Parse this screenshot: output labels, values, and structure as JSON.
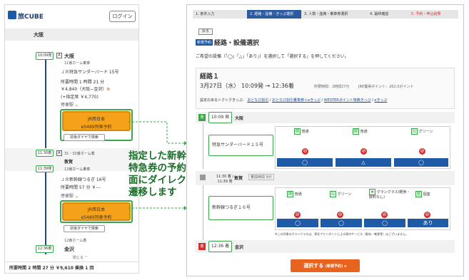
{
  "phone": {
    "logo": "旅CUBE",
    "login": "ログイン",
    "time_label": "10:09",
    "origin_header": "大阪",
    "leg1": {
      "dep_time": "10:09発",
      "platform_badge": "A",
      "station": "大阪",
      "platform": "11番ホーム乗車",
      "train": "ＪＲ特急サンダーバード 15号",
      "duration": "所要時間 1 時間 21 分",
      "fare": "￥4,840（大阪−金沢）",
      "fare_star": "※",
      "extra_fare": "(+指定席 ￥4,770)",
      "stops": "停車駅 ⌄",
      "reserve_line1": "JR西日本",
      "reserve_line2": "e5489列車予約",
      "around": "前後ダイヤで検索"
    },
    "transfer": {
      "arr_time": "11:30着",
      "badge": "A",
      "arr_platform": "31・32番ホーム着",
      "station": "敦賀",
      "dep_time": "11:39発",
      "dep_platform": "12番ホーム乗車"
    },
    "leg2": {
      "train": "ＪＲ新幹線つるぎ 16号",
      "duration": "所要時間 57 分 ￥---",
      "stops": "停車駅 ⌄",
      "reserve_line1": "JR西日本",
      "reserve_line2": "e5489列車予約",
      "around": "前後ダイヤで検索"
    },
    "arrival": {
      "platform": "12番ホーム着",
      "time": "12:36着",
      "station": "金沢",
      "close": "閉じる ⌃"
    },
    "footer": "所要時間 2 時間 27 分 ￥9,610 乗換 1 回"
  },
  "callout": [
    "指定した新幹線・",
    "特急券の予約画",
    "面にダイレクトに",
    "遷移します"
  ],
  "panel": {
    "steps": [
      "1. 条件入力",
      "2. 経路・設備・きっぷ選択",
      "3. 人数・座席・乗車券選択",
      "4. 最終確認",
      "5. 予約・申込結果"
    ],
    "back": "戻る",
    "badge": "新規予約",
    "title": "経路・設備選択",
    "instruction": "ご希望の設備（「◯」「△」「あり」）を選択して「選択する」を押してください。",
    "route_name": "経路１",
    "date": "3月27日（水）",
    "times": "10:09発 → 12:36着",
    "duration": "所要時間：2時間27分",
    "points": "JRE獲得ポイント：262.0ポイント",
    "tickets_label": "設定のあるトクトクきっぷ：",
    "tickets": [
      "おとなび割引",
      "おとなび割引乗車券＋eきっぷ",
      "WESTERポイント特典きっぷ",
      "eきっぷ"
    ],
    "dep_time": "10:09 発",
    "dep_station": "大阪",
    "train1": "特急サンダーバード１５号",
    "classes1": [
      "普通",
      "普通",
      "グリーン"
    ],
    "marks1a": [
      "🚭",
      "🚭",
      "🚭"
    ],
    "marks1b": [
      "◯",
      "△",
      "◯"
    ],
    "transfer_times": "11:30 着 / 11:39 発",
    "transfer_station": "敦賀",
    "transfer_tag": "乗換時間 9分",
    "train2": "新幹線つるぎ１６号",
    "classes2": [
      "普通",
      "グリーン",
      "グランクラス(軽食・飲料なし)",
      "個室"
    ],
    "marks2b": [
      "◯",
      "◯",
      "◯",
      "あり"
    ],
    "note": "※この列車のグランクラスは、専任アテンダントによる車内サービス（飲料・軽食等）はございません。",
    "arr_time": "12:36 着",
    "arr_station": "金沢",
    "select_btn": "選択する",
    "select_sub": "(新規予約)"
  }
}
